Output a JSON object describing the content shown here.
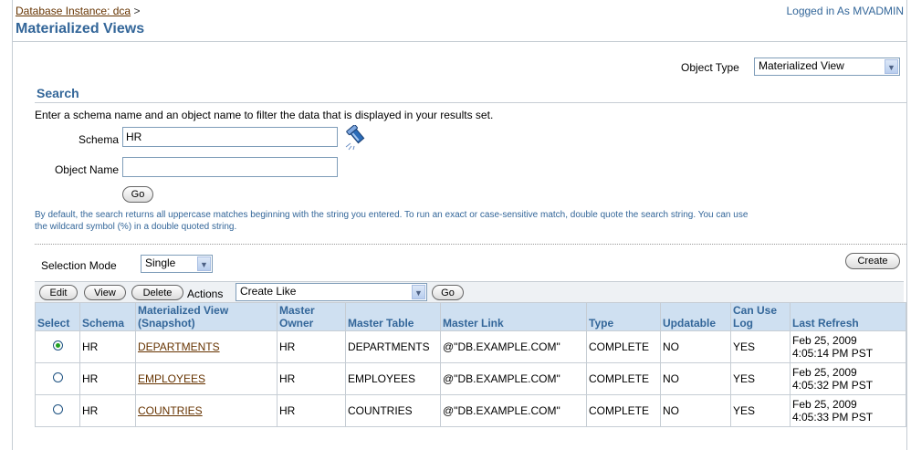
{
  "breadcrumb": {
    "link": "Database Instance: dca",
    "separator": ">"
  },
  "login_status": "Logged in As MVADMIN",
  "page_title": "Materialized Views",
  "object_type": {
    "label": "Object Type",
    "selected": "Materialized View"
  },
  "search": {
    "heading": "Search",
    "description": "Enter a schema name and an object name to filter the data that is displayed in your results set.",
    "schema_label": "Schema",
    "schema_value": "HR",
    "object_name_label": "Object Name",
    "object_name_value": "",
    "go_label": "Go",
    "hint_line1": "By default, the search returns all uppercase matches beginning with the string you entered. To run an exact or case-sensitive match, double quote the search string. You can use",
    "hint_line2": "the wildcard symbol (%) in a double quoted string."
  },
  "selection_mode": {
    "label": "Selection Mode",
    "selected": "Single"
  },
  "create_label": "Create",
  "toolbar": {
    "edit": "Edit",
    "view": "View",
    "delete": "Delete",
    "actions_label": "Actions",
    "actions_selected": "Create Like",
    "go": "Go"
  },
  "table": {
    "headers": {
      "select": "Select",
      "schema": "Schema",
      "mv_line1": "Materialized View",
      "mv_line2": "(Snapshot)",
      "owner_line1": "Master",
      "owner_line2": "Owner",
      "master_table": "Master Table",
      "master_link": "Master Link",
      "type": "Type",
      "updatable": "Updatable",
      "canuse_line1": "Can Use",
      "canuse_line2": "Log",
      "last_refresh": "Last Refresh"
    },
    "rows": [
      {
        "selected": true,
        "schema": "HR",
        "mview": "DEPARTMENTS",
        "owner": "HR",
        "master_table": "DEPARTMENTS",
        "master_link": "@\"DB.EXAMPLE.COM\"",
        "type": "COMPLETE",
        "updatable": "NO",
        "can_use_log": "YES",
        "refresh_date": "Feb 25, 2009",
        "refresh_time": "4:05:14 PM PST"
      },
      {
        "selected": false,
        "schema": "HR",
        "mview": "EMPLOYEES",
        "owner": "HR",
        "master_table": "EMPLOYEES",
        "master_link": "@\"DB.EXAMPLE.COM\"",
        "type": "COMPLETE",
        "updatable": "NO",
        "can_use_log": "YES",
        "refresh_date": "Feb 25, 2009",
        "refresh_time": "4:05:32 PM PST"
      },
      {
        "selected": false,
        "schema": "HR",
        "mview": "COUNTRIES",
        "owner": "HR",
        "master_table": "COUNTRIES",
        "master_link": "@\"DB.EXAMPLE.COM\"",
        "type": "COMPLETE",
        "updatable": "NO",
        "can_use_log": "YES",
        "refresh_date": "Feb 25, 2009",
        "refresh_time": "4:05:33 PM PST"
      }
    ]
  }
}
